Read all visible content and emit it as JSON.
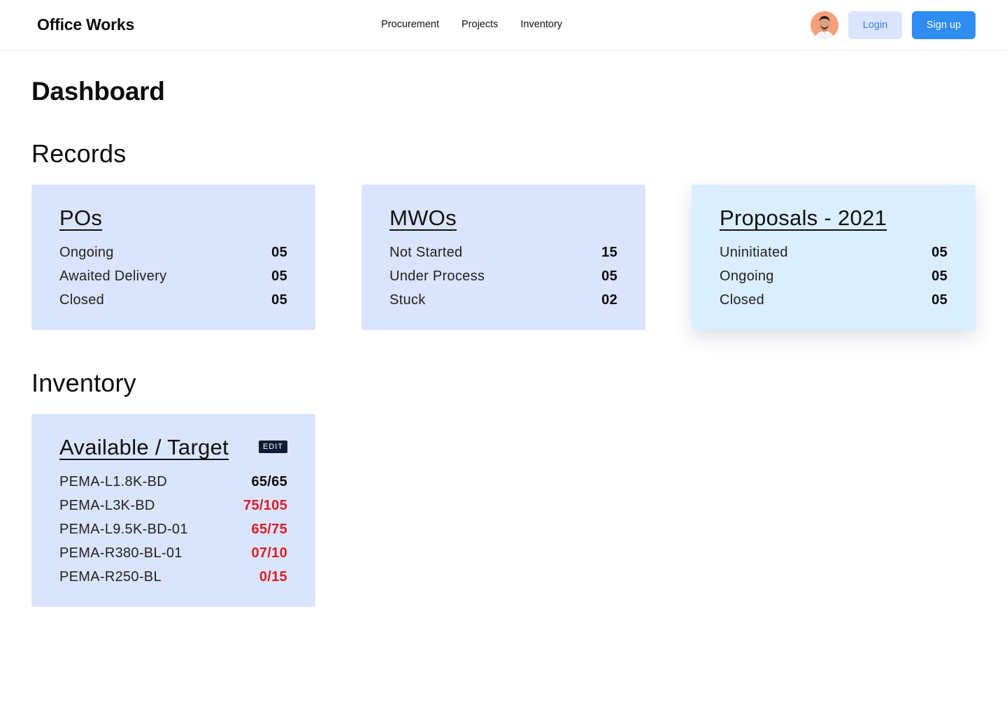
{
  "header": {
    "brand": "Office Works",
    "nav": [
      "Procurement",
      "Projects",
      "Inventory"
    ],
    "login_label": "Login",
    "signup_label": "Sign up",
    "avatar_icon": "user-avatar"
  },
  "page": {
    "title": "Dashboard"
  },
  "records": {
    "title": "Records",
    "cards": [
      {
        "title": "POs",
        "rows": [
          {
            "label": "Ongoing",
            "value": "05"
          },
          {
            "label": "Awaited Delivery",
            "value": "05"
          },
          {
            "label": "Closed",
            "value": "05"
          }
        ]
      },
      {
        "title": "MWOs",
        "rows": [
          {
            "label": "Not Started",
            "value": "15"
          },
          {
            "label": "Under Process",
            "value": "05"
          },
          {
            "label": "Stuck",
            "value": "02"
          }
        ]
      },
      {
        "title": "Proposals - 2021",
        "rows": [
          {
            "label": "Uninitiated",
            "value": "05"
          },
          {
            "label": "Ongoing",
            "value": "05"
          },
          {
            "label": "Closed",
            "value": "05"
          }
        ]
      }
    ]
  },
  "inventory": {
    "title": "Inventory",
    "card": {
      "title": "Available / Target",
      "edit_label": "EDIT",
      "rows": [
        {
          "label": "PEMA-L1.8K-BD",
          "value": "65/65",
          "status": "ok"
        },
        {
          "label": "PEMA-L3K-BD",
          "value": "75/105",
          "status": "short"
        },
        {
          "label": "PEMA-L9.5K-BD-01",
          "value": "65/75",
          "status": "short"
        },
        {
          "label": "PEMA-R380-BL-01",
          "value": "07/10",
          "status": "short"
        },
        {
          "label": "PEMA-R250-BL",
          "value": "0/15",
          "status": "short"
        }
      ]
    }
  },
  "colors": {
    "card_bg": "#dbe4fd",
    "card_highlight_bg": "#dbeeff",
    "primary": "#2f8cf0",
    "alert": "#d81e26",
    "badge_bg": "#0c1c35"
  }
}
